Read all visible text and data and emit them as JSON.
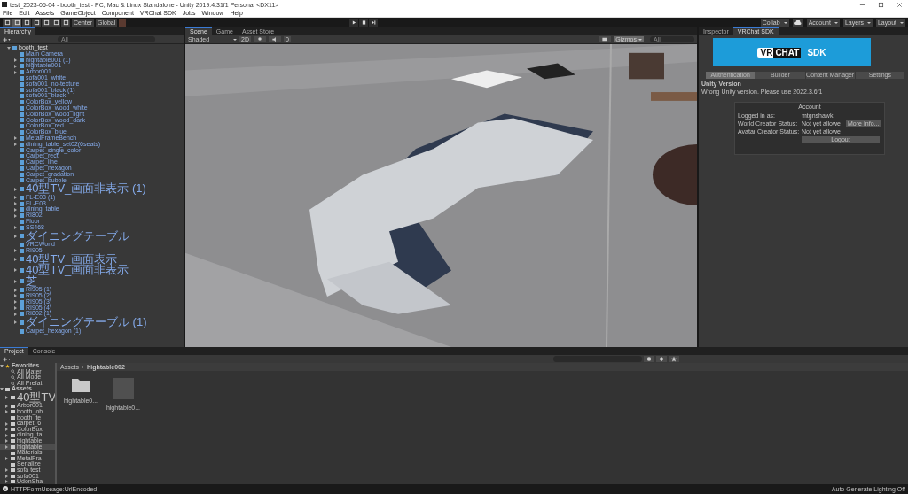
{
  "window": {
    "title": "test_2023-05-04 - booth_test - PC, Mac & Linux Standalone - Unity 2019.4.31f1 Personal <DX11>"
  },
  "menu": [
    "File",
    "Edit",
    "Assets",
    "GameObject",
    "Component",
    "VRChat SDK",
    "Jobs",
    "Window",
    "Help"
  ],
  "toolbar": {
    "pivot": "Center",
    "space": "Global",
    "right": [
      "Collab",
      "Account",
      "Layers",
      "Layout"
    ]
  },
  "hierarchy": {
    "tab": "Hierarchy",
    "search": {
      "placeholder": "All"
    },
    "root": {
      "name": "booth_test",
      "expanded": true,
      "children": [
        {
          "name": "Main Camera",
          "expandable": false
        },
        {
          "name": "hightable001 (1)",
          "expandable": true
        },
        {
          "name": "hightable001",
          "expandable": true
        },
        {
          "name": "Arbor001",
          "expandable": true
        },
        {
          "name": "sofa001_white",
          "expandable": false
        },
        {
          "name": "sofa001_no-texture",
          "expandable": false
        },
        {
          "name": "sofa001_black (1)",
          "expandable": false
        },
        {
          "name": "sofa001_black",
          "expandable": false
        },
        {
          "name": "ColorBox_yellow",
          "expandable": false
        },
        {
          "name": "ColorBox_wood_white",
          "expandable": false
        },
        {
          "name": "ColorBox_wood_light",
          "expandable": false
        },
        {
          "name": "ColorBox_wood_dark",
          "expandable": false
        },
        {
          "name": "ColorBox_red",
          "expandable": false
        },
        {
          "name": "ColorBox_blue",
          "expandable": false
        },
        {
          "name": "MetalFrameBench",
          "expandable": true
        },
        {
          "name": "dining_table_set02(6seats)",
          "expandable": true
        },
        {
          "name": "Carpet_single_color",
          "expandable": false
        },
        {
          "name": "Carpet_rect",
          "expandable": false
        },
        {
          "name": "Carpet_line",
          "expandable": false
        },
        {
          "name": "Carpet_hexagon",
          "expandable": false
        },
        {
          "name": "Carpet_gradation",
          "expandable": false
        },
        {
          "name": "Carpet_bubble",
          "expandable": false
        },
        {
          "name": "40型TV_画面非表示 (1)",
          "expandable": true
        },
        {
          "name": "FL-E03 (1)",
          "expandable": true
        },
        {
          "name": "FL-E03",
          "expandable": true
        },
        {
          "name": "dining_table",
          "expandable": true
        },
        {
          "name": "RI802",
          "expandable": true
        },
        {
          "name": "Floor",
          "expandable": false
        },
        {
          "name": "SS468",
          "expandable": true
        },
        {
          "name": "ダイニングテーブル",
          "expandable": true
        },
        {
          "name": "VRCWorld",
          "expandable": false
        },
        {
          "name": "RI905",
          "expandable": true
        },
        {
          "name": "40型TV_画面表示",
          "expandable": true
        },
        {
          "name": "40型TV_画面非表示",
          "expandable": true
        },
        {
          "name": "芝",
          "expandable": true
        },
        {
          "name": "RI905 (1)",
          "expandable": true
        },
        {
          "name": "RI905 (2)",
          "expandable": true
        },
        {
          "name": "RI905 (3)",
          "expandable": true
        },
        {
          "name": "RI905 (4)",
          "expandable": true
        },
        {
          "name": "RI802 (1)",
          "expandable": true
        },
        {
          "name": "ダイニングテーブル (1)",
          "expandable": true
        },
        {
          "name": "Carpet_hexagon (1)",
          "expandable": false
        }
      ]
    }
  },
  "scene": {
    "tabs": [
      {
        "label": "Scene",
        "selected": true
      },
      {
        "label": "Game",
        "selected": false
      },
      {
        "label": "Asset Store",
        "selected": false
      }
    ],
    "shading": "Shaded",
    "mode": "2D",
    "effects_count": "0",
    "gizmos": "Gizmos",
    "search": {
      "placeholder": "All"
    }
  },
  "inspector": {
    "tabs": [
      {
        "label": "Inspector",
        "selected": false
      },
      {
        "label": "VRChat SDK",
        "selected": true
      }
    ],
    "logo": {
      "left": "VR",
      "boxed": "CHAT",
      "right": "SDK"
    },
    "sdk_tabs": [
      {
        "label": "Authentication",
        "selected": true
      },
      {
        "label": "Builder",
        "selected": false
      },
      {
        "label": "Content Manager",
        "selected": false
      },
      {
        "label": "Settings",
        "selected": false
      }
    ],
    "heading": "Unity Version",
    "message": "Wrong Unity version. Please use 2022.3.6f1",
    "account": {
      "title": "Account",
      "rows": [
        {
          "label": "Logged in as:",
          "value": "mtgnshawk"
        },
        {
          "label": "World Creator Status:",
          "value": "Not yet allowe",
          "button": "More Info..."
        },
        {
          "label": "Avatar Creator Status:",
          "value": "Not yet allowe"
        }
      ],
      "logout": "Logout"
    }
  },
  "project": {
    "tabs": [
      {
        "label": "Project",
        "selected": true
      },
      {
        "label": "Console",
        "selected": false
      }
    ],
    "favorites": {
      "label": "Favorites",
      "items": [
        "All Mater",
        "All Mode",
        "All Prefat"
      ]
    },
    "assets": {
      "label": "Assets",
      "items": [
        {
          "name": "40型TV",
          "expandable": true,
          "selected": false
        },
        {
          "name": "Arbor001",
          "expandable": true,
          "selected": false
        },
        {
          "name": "booth_ob",
          "expandable": true,
          "selected": false
        },
        {
          "name": "booth_te",
          "expandable": false,
          "selected": false
        },
        {
          "name": "carpet_6",
          "expandable": true,
          "selected": false
        },
        {
          "name": "ColorBox",
          "expandable": true,
          "selected": false
        },
        {
          "name": "dining_ta",
          "expandable": true,
          "selected": false
        },
        {
          "name": "hightable",
          "expandable": true,
          "selected": false
        },
        {
          "name": "hightable",
          "expandable": true,
          "selected": true
        },
        {
          "name": "Materials",
          "expandable": false,
          "selected": false
        },
        {
          "name": "MetalFra",
          "expandable": true,
          "selected": false
        },
        {
          "name": "Serialize",
          "expandable": false,
          "selected": false
        },
        {
          "name": "sofa test",
          "expandable": true,
          "selected": false
        },
        {
          "name": "sofa001",
          "expandable": true,
          "selected": false
        },
        {
          "name": "UdonSha",
          "expandable": true,
          "selected": false
        }
      ]
    },
    "breadcrumb": [
      "Assets",
      "hightable002"
    ],
    "files": [
      {
        "name": "hightable0...",
        "kind": "folder"
      },
      {
        "name": "hightable0...",
        "kind": "prefab"
      }
    ]
  },
  "status_bar": {
    "message": "HTTPFormUseage:UrlEncoded",
    "right": "Auto Generate Lighting Off"
  }
}
